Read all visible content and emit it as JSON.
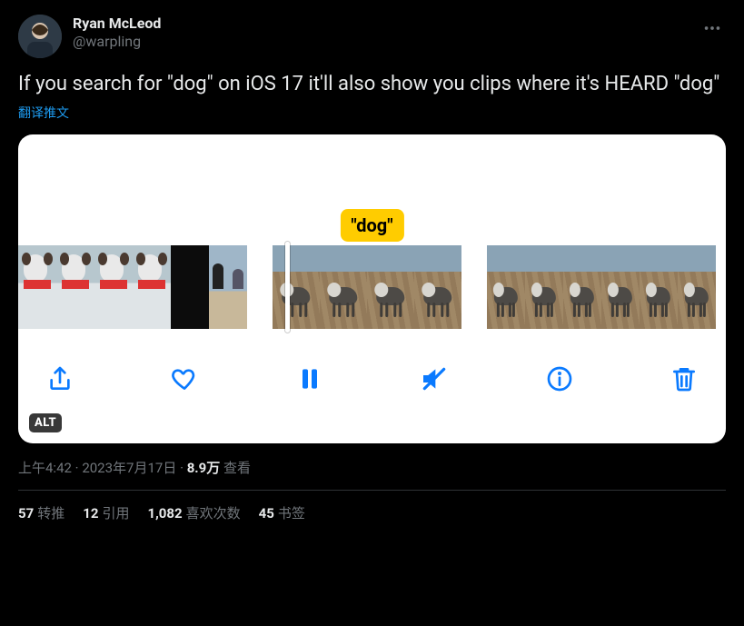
{
  "author": {
    "display_name": "Ryan McLeod",
    "handle": "@warpling"
  },
  "tweet_text": "If you search for \"dog\" on iOS 17 it'll also show you clips where it's HEARD \"dog\"",
  "translate_label": "翻译推文",
  "media": {
    "caption_label": "\"dog\"",
    "alt_badge": "ALT",
    "toolbar_icons": {
      "share": "share-icon",
      "heart": "heart-icon",
      "pause": "pause-icon",
      "mute": "mute-icon",
      "info": "info-icon",
      "trash": "trash-icon"
    }
  },
  "meta": {
    "time": "上午4:42",
    "date": "2023年7月17日",
    "views_number": "8.9万",
    "views_label": "查看"
  },
  "stats": {
    "retweets": {
      "count": "57",
      "label": "转推"
    },
    "quotes": {
      "count": "12",
      "label": "引用"
    },
    "likes": {
      "count": "1,082",
      "label": "喜欢次数"
    },
    "bookmarks": {
      "count": "45",
      "label": "书签"
    }
  }
}
